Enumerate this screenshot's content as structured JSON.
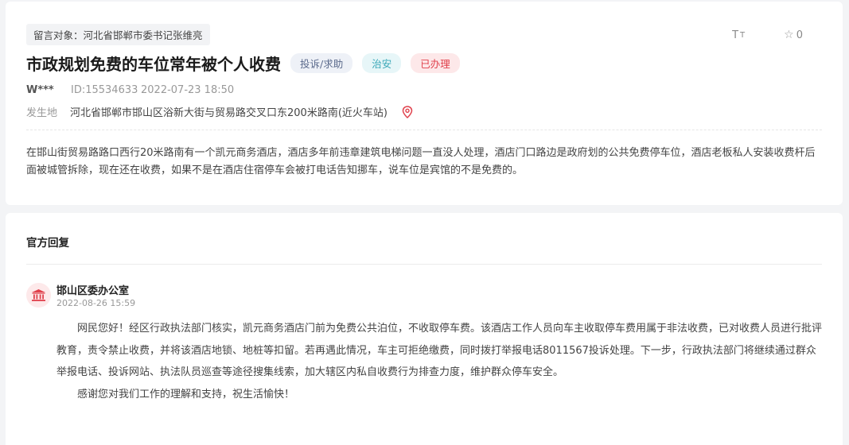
{
  "message": {
    "target": "留言对象：河北省邯郸市委书记张维亮",
    "title": "市政规划免费的车位常年被个人收费",
    "badges": {
      "category": "投诉/求助",
      "topic": "治安",
      "status": "已办理"
    },
    "author": "W***",
    "id": "ID:15534633",
    "datetime": "2022-07-23 18:50",
    "place_label": "发生地",
    "place": "河北省邯郸市邯山区浴新大街与贸易路交叉口东200米路南(近火车站)",
    "content": "在邯山街贸易路路口西行20米路南有一个凯元商务酒店，酒店多年前违章建筑电梯问题一直没人处理，酒店门口路边是政府划的公共免费停车位，酒店老板私人安装收费杆后面被城管拆除，现在还在收费，如果不是在酒店住宿停车会被打电话告知挪车，说车位是宾馆的不是免费的。"
  },
  "tools": {
    "font_icon": "font-size-icon",
    "favorite_count": "0",
    "favorite_icon": "star-outline-icon"
  },
  "reply": {
    "heading": "官方回复",
    "org_name": "邯山区委办公室",
    "org_icon": "government-building-icon",
    "datetime": "2022-08-26 15:59",
    "paragraphs": [
      "网民您好！经区行政执法部门核实，凯元商务酒店门前为免费公共泊位，不收取停车费。该酒店工作人员向车主收取停车费用属于非法收费，已对收费人员进行批评教育，责令禁止收费，并将该酒店地锁、地桩等扣留。若再遇此情况，车主可拒绝缴费，同时拨打举报电话8011567投诉处理。下一步，行政执法部门将继续通过群众举报电话、投诉网站、执法队员巡查等途径搜集线索，加大辖区内私自收费行为排查力度，维护群众停车安全。",
      "感谢您对我们工作的理解和支持，祝生活愉快！"
    ]
  },
  "colors": {
    "status_red": "#e0414c",
    "topic_cyan": "#3ba8b8",
    "category_blue": "#5b6a8c",
    "pin_red": "#e0414c"
  }
}
